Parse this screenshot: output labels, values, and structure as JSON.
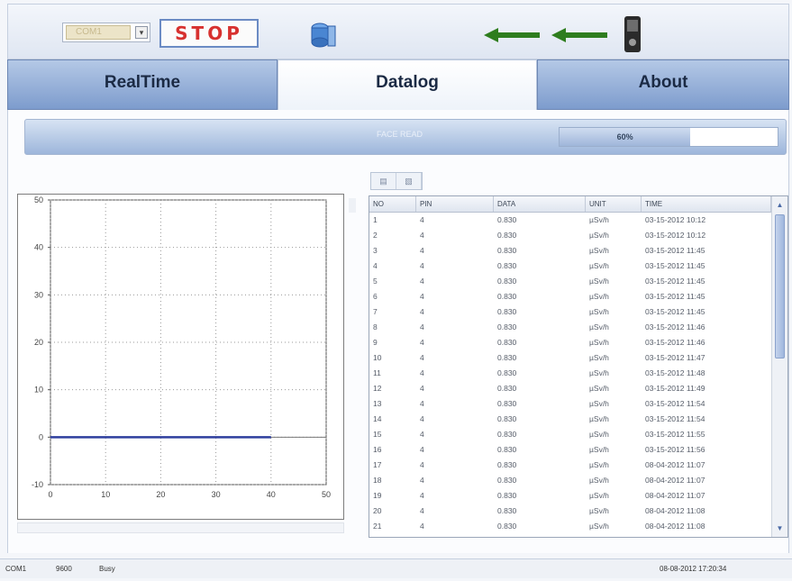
{
  "toolbar": {
    "com_port_value": "COM1",
    "com_dropdown_glyph": "▾",
    "stop_label": "STOP",
    "icons": [
      "device-icon",
      "left-arrow-icon",
      "left-arrow-icon",
      "phone-icon"
    ],
    "arrow_color": "#2e7d1e"
  },
  "tabs": [
    {
      "label": "RealTime",
      "active": false
    },
    {
      "label": "Datalog",
      "active": true
    },
    {
      "label": "About",
      "active": false
    }
  ],
  "progress": {
    "label": "FACE READ",
    "percent_text": "60%",
    "fraction": 0.6
  },
  "mini_buttons": [
    "▤",
    "▧"
  ],
  "chart_data": {
    "type": "line",
    "xlim": [
      0,
      50
    ],
    "ylim": [
      -10,
      50
    ],
    "x_ticks": [
      "0",
      "10",
      "20",
      "30",
      "40",
      "50"
    ],
    "y_ticks": [
      "-10",
      "0",
      "10",
      "20",
      "30",
      "40",
      "50"
    ],
    "grid": true,
    "series": [
      {
        "x": [
          0,
          40
        ],
        "y": [
          0,
          0
        ],
        "color": "#2f3f9e"
      }
    ]
  },
  "table": {
    "columns": [
      "NO",
      "PIN",
      "DATA",
      "UNIT",
      "TIME"
    ],
    "rows": [
      [
        "1",
        "4",
        "0.830",
        "µSv/h",
        "03-15-2012 10:12"
      ],
      [
        "2",
        "4",
        "0.830",
        "µSv/h",
        "03-15-2012 10:12"
      ],
      [
        "3",
        "4",
        "0.830",
        "µSv/h",
        "03-15-2012 11:45"
      ],
      [
        "4",
        "4",
        "0.830",
        "µSv/h",
        "03-15-2012 11:45"
      ],
      [
        "5",
        "4",
        "0.830",
        "µSv/h",
        "03-15-2012 11:45"
      ],
      [
        "6",
        "4",
        "0.830",
        "µSv/h",
        "03-15-2012 11:45"
      ],
      [
        "7",
        "4",
        "0.830",
        "µSv/h",
        "03-15-2012 11:45"
      ],
      [
        "8",
        "4",
        "0.830",
        "µSv/h",
        "03-15-2012 11:46"
      ],
      [
        "9",
        "4",
        "0.830",
        "µSv/h",
        "03-15-2012 11:46"
      ],
      [
        "10",
        "4",
        "0.830",
        "µSv/h",
        "03-15-2012 11:47"
      ],
      [
        "11",
        "4",
        "0.830",
        "µSv/h",
        "03-15-2012 11:48"
      ],
      [
        "12",
        "4",
        "0.830",
        "µSv/h",
        "03-15-2012 11:49"
      ],
      [
        "13",
        "4",
        "0.830",
        "µSv/h",
        "03-15-2012 11:54"
      ],
      [
        "14",
        "4",
        "0.830",
        "µSv/h",
        "03-15-2012 11:54"
      ],
      [
        "15",
        "4",
        "0.830",
        "µSv/h",
        "03-15-2012 11:55"
      ],
      [
        "16",
        "4",
        "0.830",
        "µSv/h",
        "03-15-2012 11:56"
      ],
      [
        "17",
        "4",
        "0.830",
        "µSv/h",
        "08-04-2012 11:07"
      ],
      [
        "18",
        "4",
        "0.830",
        "µSv/h",
        "08-04-2012 11:07"
      ],
      [
        "19",
        "4",
        "0.830",
        "µSv/h",
        "08-04-2012 11:07"
      ],
      [
        "20",
        "4",
        "0.830",
        "µSv/h",
        "08-04-2012 11:08"
      ],
      [
        "21",
        "4",
        "0.830",
        "µSv/h",
        "08-04-2012 11:08"
      ]
    ]
  },
  "statusbar": {
    "port": "COM1",
    "baud": "9600",
    "state": "Busy",
    "datetime": "08-08-2012 17:20:34"
  }
}
